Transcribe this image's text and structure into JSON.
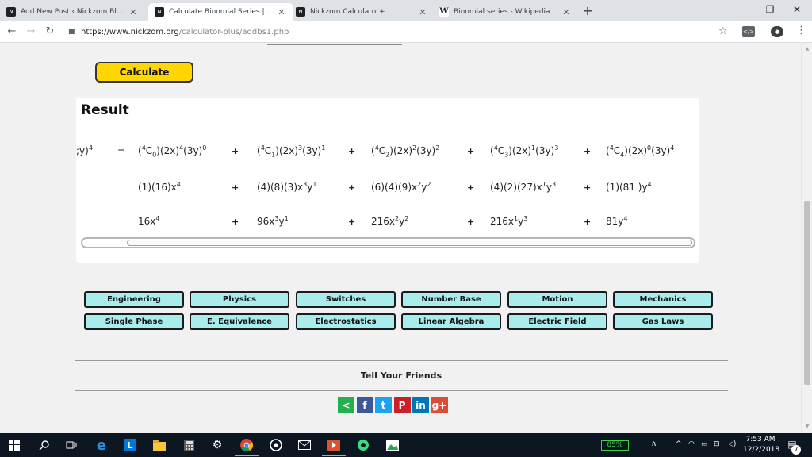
{
  "browser": {
    "tabs": [
      {
        "title": "Add New Post ‹ Nickzom Blog —",
        "favicon": "nickzom-icon",
        "active": false
      },
      {
        "title": "Calculate Binomial Series | Additi",
        "favicon": "nickzom-icon",
        "active": true
      },
      {
        "title": "Nickzom Calculator+",
        "favicon": "nickzom-icon",
        "active": false
      },
      {
        "title": "Binomial series - Wikipedia",
        "favicon": "wikipedia-icon",
        "active": false
      }
    ],
    "url_host": "https://www.nickzom.org",
    "url_path": "/calculator-plus/addbs1.php",
    "window_controls": {
      "minimize": "—",
      "restore": "❐",
      "close": "✕"
    }
  },
  "page": {
    "calculate_label": "Calculate",
    "result_heading": "Result",
    "lhs": ";y)",
    "lhs_exp": "4",
    "equals": "=",
    "plus": "+",
    "row1": [
      {
        "pre": "(",
        "sup": "4",
        "base": "C",
        "sub": "0",
        "mid": ")(2x)",
        "e1": "4",
        "mid2": "(3y)",
        "e2": "0"
      },
      {
        "pre": "(",
        "sup": "4",
        "base": "C",
        "sub": "1",
        "mid": ")(2x)",
        "e1": "3",
        "mid2": "(3y)",
        "e2": "1"
      },
      {
        "pre": "(",
        "sup": "4",
        "base": "C",
        "sub": "2",
        "mid": ")(2x)",
        "e1": "2",
        "mid2": "(3y)",
        "e2": "2"
      },
      {
        "pre": "(",
        "sup": "4",
        "base": "C",
        "sub": "3",
        "mid": ")(2x)",
        "e1": "1",
        "mid2": "(3y)",
        "e2": "3"
      },
      {
        "pre": "(",
        "sup": "4",
        "base": "C",
        "sub": "4",
        "mid": ")(2x)",
        "e1": "0",
        "mid2": "(3y)",
        "e2": "4"
      }
    ],
    "row2": [
      {
        "text": "(1)(16)x",
        "e1": "4",
        "tail": "",
        "e2": ""
      },
      {
        "text": "(4)(8)(3)x",
        "e1": "3",
        "tail": "y",
        "e2": "1"
      },
      {
        "text": "(6)(4)(9)x",
        "e1": "2",
        "tail": "y",
        "e2": "2"
      },
      {
        "text": "(4)(2)(27)x",
        "e1": "1",
        "tail": "y",
        "e2": "3"
      },
      {
        "text": "(1)(81 )y",
        "e1": "4",
        "tail": "",
        "e2": ""
      }
    ],
    "row3": [
      {
        "text": "16x",
        "e1": "4",
        "tail": "",
        "e2": ""
      },
      {
        "text": "96x",
        "e1": "3",
        "tail": "y",
        "e2": "1"
      },
      {
        "text": "216x",
        "e1": "2",
        "tail": "y",
        "e2": "2"
      },
      {
        "text": "216x",
        "e1": "1",
        "tail": "y",
        "e2": "3"
      },
      {
        "text": "81y",
        "e1": "4",
        "tail": "",
        "e2": ""
      }
    ],
    "categories": [
      [
        "Engineering",
        "Physics",
        "Switches",
        "Number Base",
        "Motion",
        "Mechanics"
      ],
      [
        "Single Phase",
        "E. Equivalence",
        "Electrostatics",
        "Linear Algebra",
        "Electric Field",
        "Gas Laws"
      ]
    ],
    "tell_friends": "Tell Your Friends",
    "share_buttons": [
      {
        "name": "share-icon",
        "glyph": "<",
        "color": "#22b14c"
      },
      {
        "name": "facebook-icon",
        "glyph": "f",
        "color": "#3b5998"
      },
      {
        "name": "twitter-icon",
        "glyph": "t",
        "color": "#1da1f2"
      },
      {
        "name": "pinterest-icon",
        "glyph": "P",
        "color": "#cb2027"
      },
      {
        "name": "linkedin-icon",
        "glyph": "in",
        "color": "#0077b5"
      },
      {
        "name": "google-plus-icon",
        "glyph": "g+",
        "color": "#dd4b39"
      }
    ]
  },
  "taskbar": {
    "battery": "85%",
    "time": "7:53 AM",
    "date": "12/2/2018",
    "notifications": "7"
  },
  "colors": {
    "calculate_button": "#ffd600",
    "category_button": "#a8ecec",
    "taskbar": "#0d1722"
  }
}
